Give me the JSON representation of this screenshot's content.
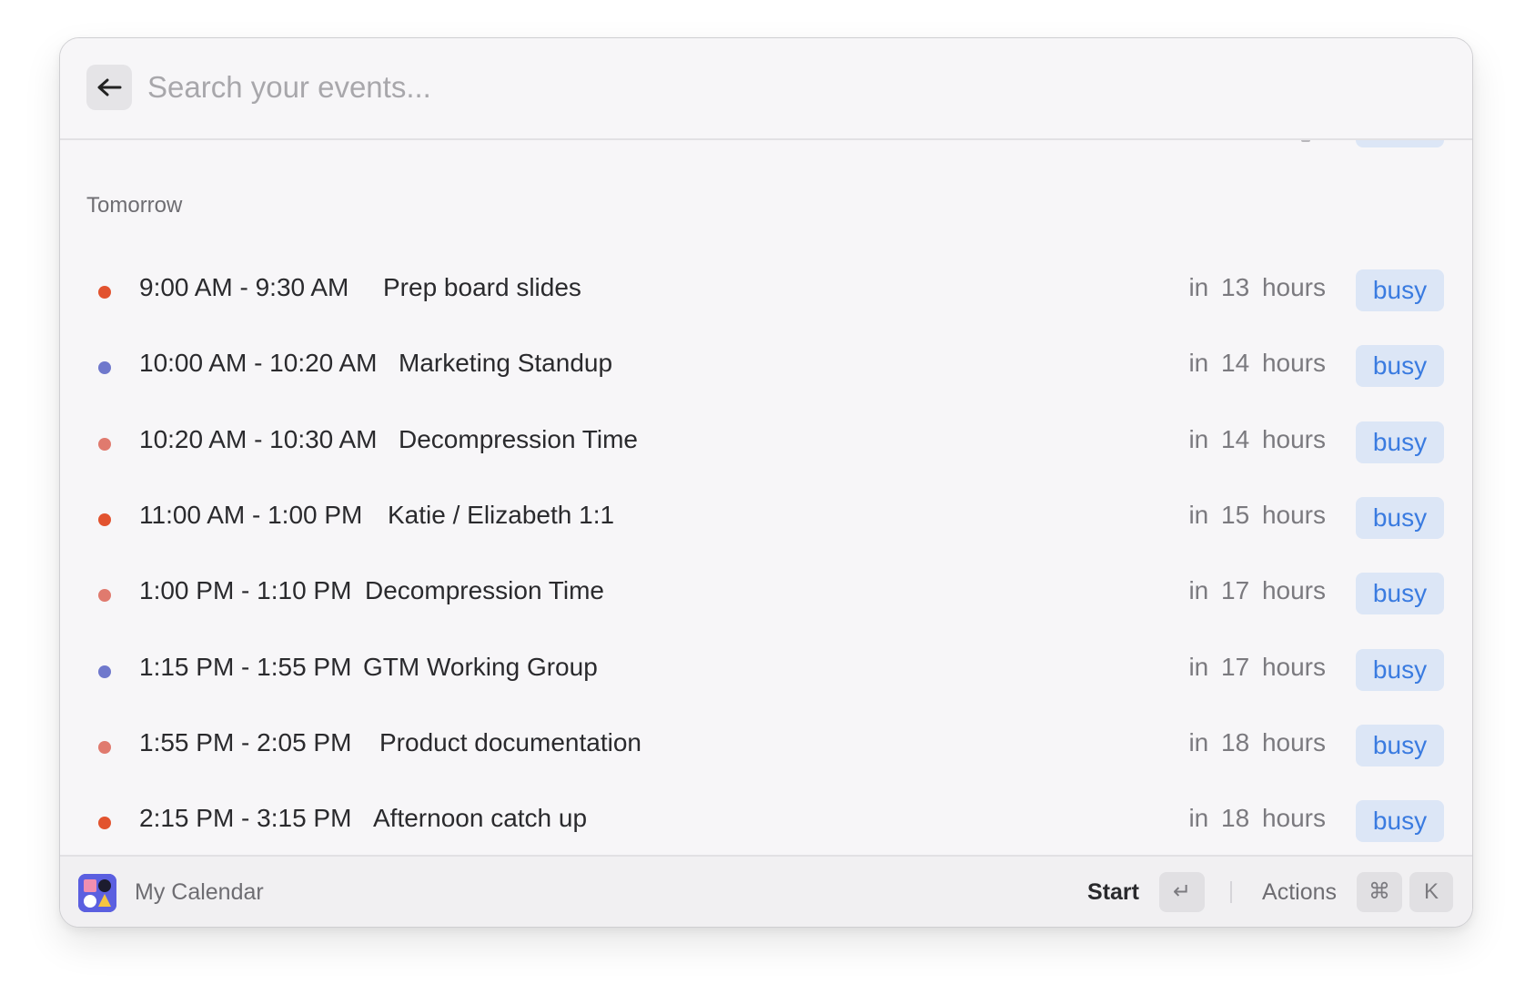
{
  "search": {
    "placeholder": "Search your events..."
  },
  "section": {
    "label": "Tomorrow"
  },
  "events": [
    {
      "time": "9:00 AM - 9:30 AM",
      "title": "Prep board slides",
      "relative": "in 13 hours",
      "status": "busy",
      "dot_color": "#e2532f"
    },
    {
      "time": "10:00 AM - 10:20 AM",
      "title": "Marketing Standup",
      "relative": "in 14 hours",
      "status": "busy",
      "dot_color": "#6f78cc"
    },
    {
      "time": "10:20 AM - 10:30 AM",
      "title": "Decompression Time",
      "relative": "in 14 hours",
      "status": "busy",
      "dot_color": "#e07a6e"
    },
    {
      "time": "11:00 AM - 1:00 PM",
      "title": "Katie / Elizabeth 1:1",
      "relative": "in 15 hours",
      "status": "busy",
      "dot_color": "#e2532f"
    },
    {
      "time": "1:00 PM - 1:10 PM",
      "title": "Decompression Time",
      "relative": "in 17 hours",
      "status": "busy",
      "dot_color": "#e07a6e"
    },
    {
      "time": "1:15 PM - 1:55 PM",
      "title": "GTM Working Group",
      "relative": "in 17 hours",
      "status": "busy",
      "dot_color": "#6f78cc"
    },
    {
      "time": "1:55 PM - 2:05 PM",
      "title": "Product documentation",
      "relative": "in 18 hours",
      "status": "busy",
      "dot_color": "#e07a6e"
    },
    {
      "time": "2:15 PM - 3:15 PM",
      "title": "Afternoon catch up",
      "relative": "in 18 hours",
      "status": "busy",
      "dot_color": "#e2532f"
    }
  ],
  "footer": {
    "app_name": "My Calendar",
    "app_icon": "calendar-app-icon",
    "start_label": "Start",
    "enter_key": "↵",
    "actions_label": "Actions",
    "cmd_key": "⌘",
    "k_key": "K"
  },
  "colors": {
    "badge_bg": "#dce6f6",
    "badge_text": "#3a7be0"
  }
}
